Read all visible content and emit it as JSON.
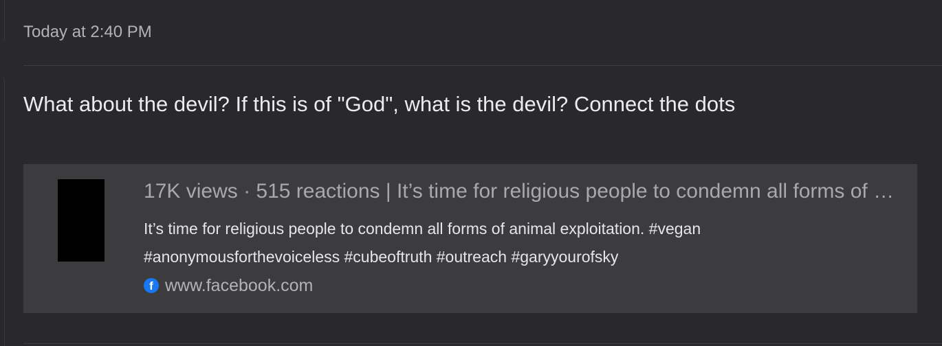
{
  "message_meta": {
    "timestamp": "Today at 2:40 PM"
  },
  "message": {
    "text": "What about the devil? If this is of \"God\", what is the devil? Connect the dots"
  },
  "link_preview": {
    "title": "17K views · 515 reactions | It’s time for religious people to condemn all forms of animal exploitation.",
    "description": "It’s time for religious people to condemn all forms of animal exploitation. #vegan #anonymousforthevoiceless #cubeoftruth #outreach #garyyourofsky",
    "source_icon": "facebook-icon",
    "source_domain": "www.facebook.com",
    "icon_glyph": "f"
  },
  "colors": {
    "background": "#29292b",
    "card_background": "#3c3c3e",
    "facebook_blue": "#1877f2"
  }
}
